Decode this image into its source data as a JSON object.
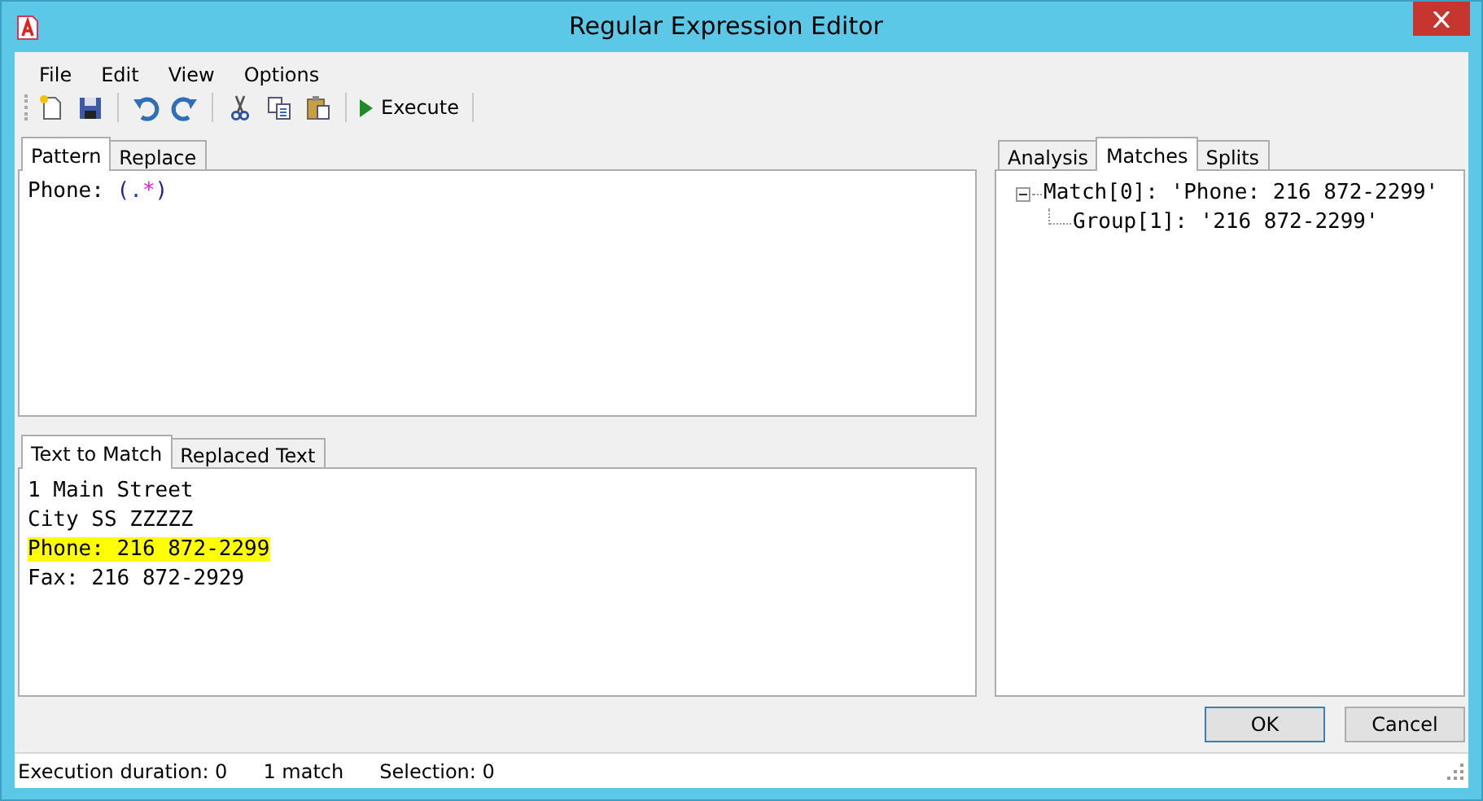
{
  "window": {
    "title": "Regular Expression Editor"
  },
  "menu": [
    "File",
    "Edit",
    "View",
    "Options"
  ],
  "toolbar": [
    {
      "kind": "new"
    },
    {
      "kind": "save"
    },
    {
      "kind": "separator"
    },
    {
      "kind": "undo"
    },
    {
      "kind": "redo"
    },
    {
      "kind": "separator"
    },
    {
      "kind": "cut"
    },
    {
      "kind": "copy"
    },
    {
      "kind": "paste"
    },
    {
      "kind": "separator"
    },
    {
      "kind": "execute",
      "label": "Execute"
    }
  ],
  "pattern_tabs": [
    {
      "label": "Pattern",
      "selected": true
    },
    {
      "label": "Replace",
      "selected": false
    }
  ],
  "pattern": [
    {
      "kind": "literal",
      "text": "Phone: "
    },
    {
      "kind": "group",
      "text": "("
    },
    {
      "kind": "any_repeat",
      "text": ".*"
    },
    {
      "kind": "group",
      "text": ")"
    }
  ],
  "text_tabs": [
    {
      "label": "Text to Match",
      "selected": true
    },
    {
      "label": "Replaced Text",
      "selected": false
    }
  ],
  "text_lines": [
    {
      "text": "1 Main Street",
      "highlighted": false
    },
    {
      "text": "City SS ZZZZZ",
      "highlighted": false
    },
    {
      "text": "Phone: 216 872-2299",
      "highlighted": true
    },
    {
      "text": "Fax: 216 872-2929",
      "highlighted": false
    }
  ],
  "result_tabs": [
    {
      "label": "Analysis",
      "selected": false
    },
    {
      "label": "Matches",
      "selected": true
    },
    {
      "label": "Splits",
      "selected": false
    }
  ],
  "matches": [
    {
      "label": "Match[0]: 'Phone: 216 872-2299'",
      "expanded": true,
      "children": [
        {
          "label": "Group[1]: '216 872-2299'"
        }
      ]
    }
  ],
  "buttons": [
    "OK",
    "Cancel"
  ],
  "status_bar": [
    "Execution duration: 0",
    "1 match",
    "Selection: 0"
  ]
}
